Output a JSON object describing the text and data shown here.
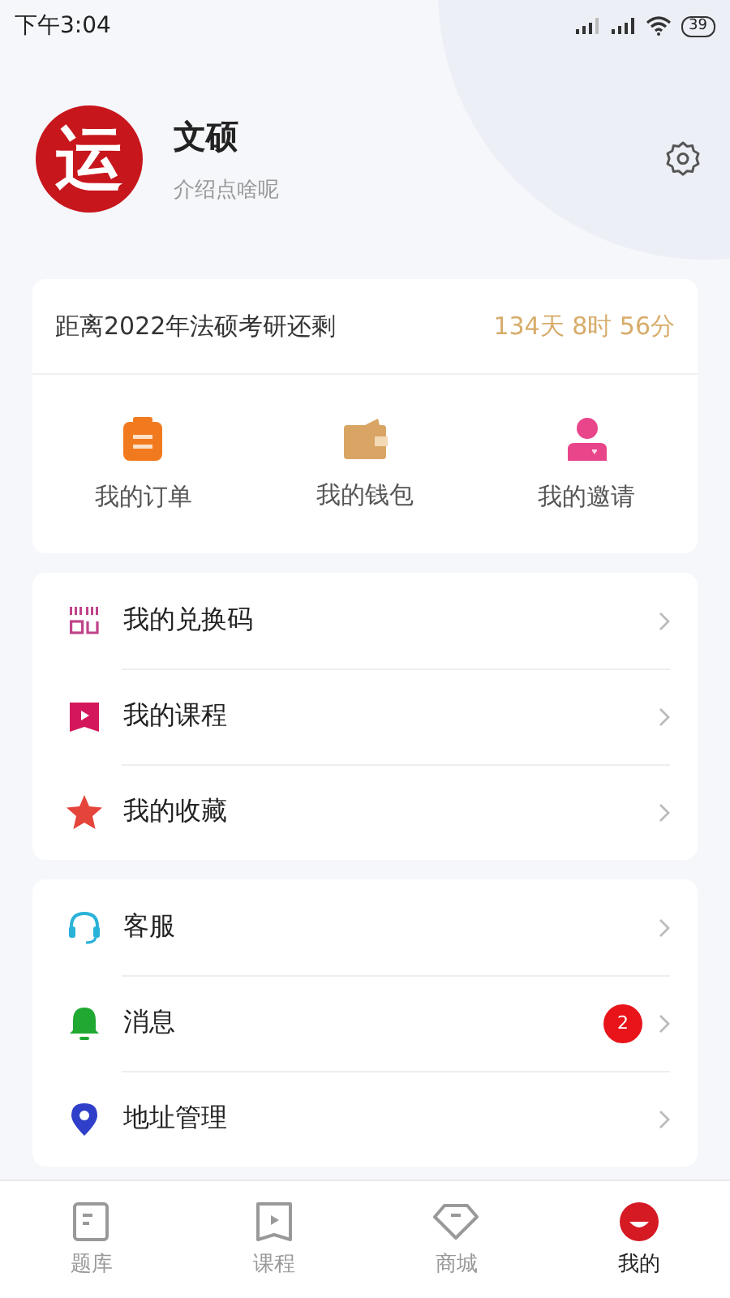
{
  "status_bar": {
    "time": "下午3:04",
    "battery": "39"
  },
  "profile": {
    "avatar_text": "运",
    "name": "文硕",
    "bio": "介绍点啥呢"
  },
  "countdown": {
    "label": "距离2022年法硕考研还剩",
    "remaining": "134天 8时 56分"
  },
  "shortcuts": [
    {
      "kind": "order",
      "label": "我的订单"
    },
    {
      "kind": "wallet",
      "label": "我的钱包"
    },
    {
      "kind": "invite",
      "label": "我的邀请"
    }
  ],
  "menu_groups": [
    [
      {
        "kind": "code",
        "label": "我的兑换码"
      },
      {
        "kind": "course",
        "label": "我的课程"
      },
      {
        "kind": "favorite",
        "label": "我的收藏"
      }
    ],
    [
      {
        "kind": "service",
        "label": "客服"
      },
      {
        "kind": "message",
        "label": "消息",
        "badge": "2"
      },
      {
        "kind": "address",
        "label": "地址管理"
      }
    ]
  ],
  "tabs": [
    {
      "kind": "questions",
      "label": "题库",
      "selected": false
    },
    {
      "kind": "course",
      "label": "课程",
      "selected": false
    },
    {
      "kind": "shop",
      "label": "商城",
      "selected": false
    },
    {
      "kind": "me",
      "label": "我的",
      "selected": true
    }
  ]
}
